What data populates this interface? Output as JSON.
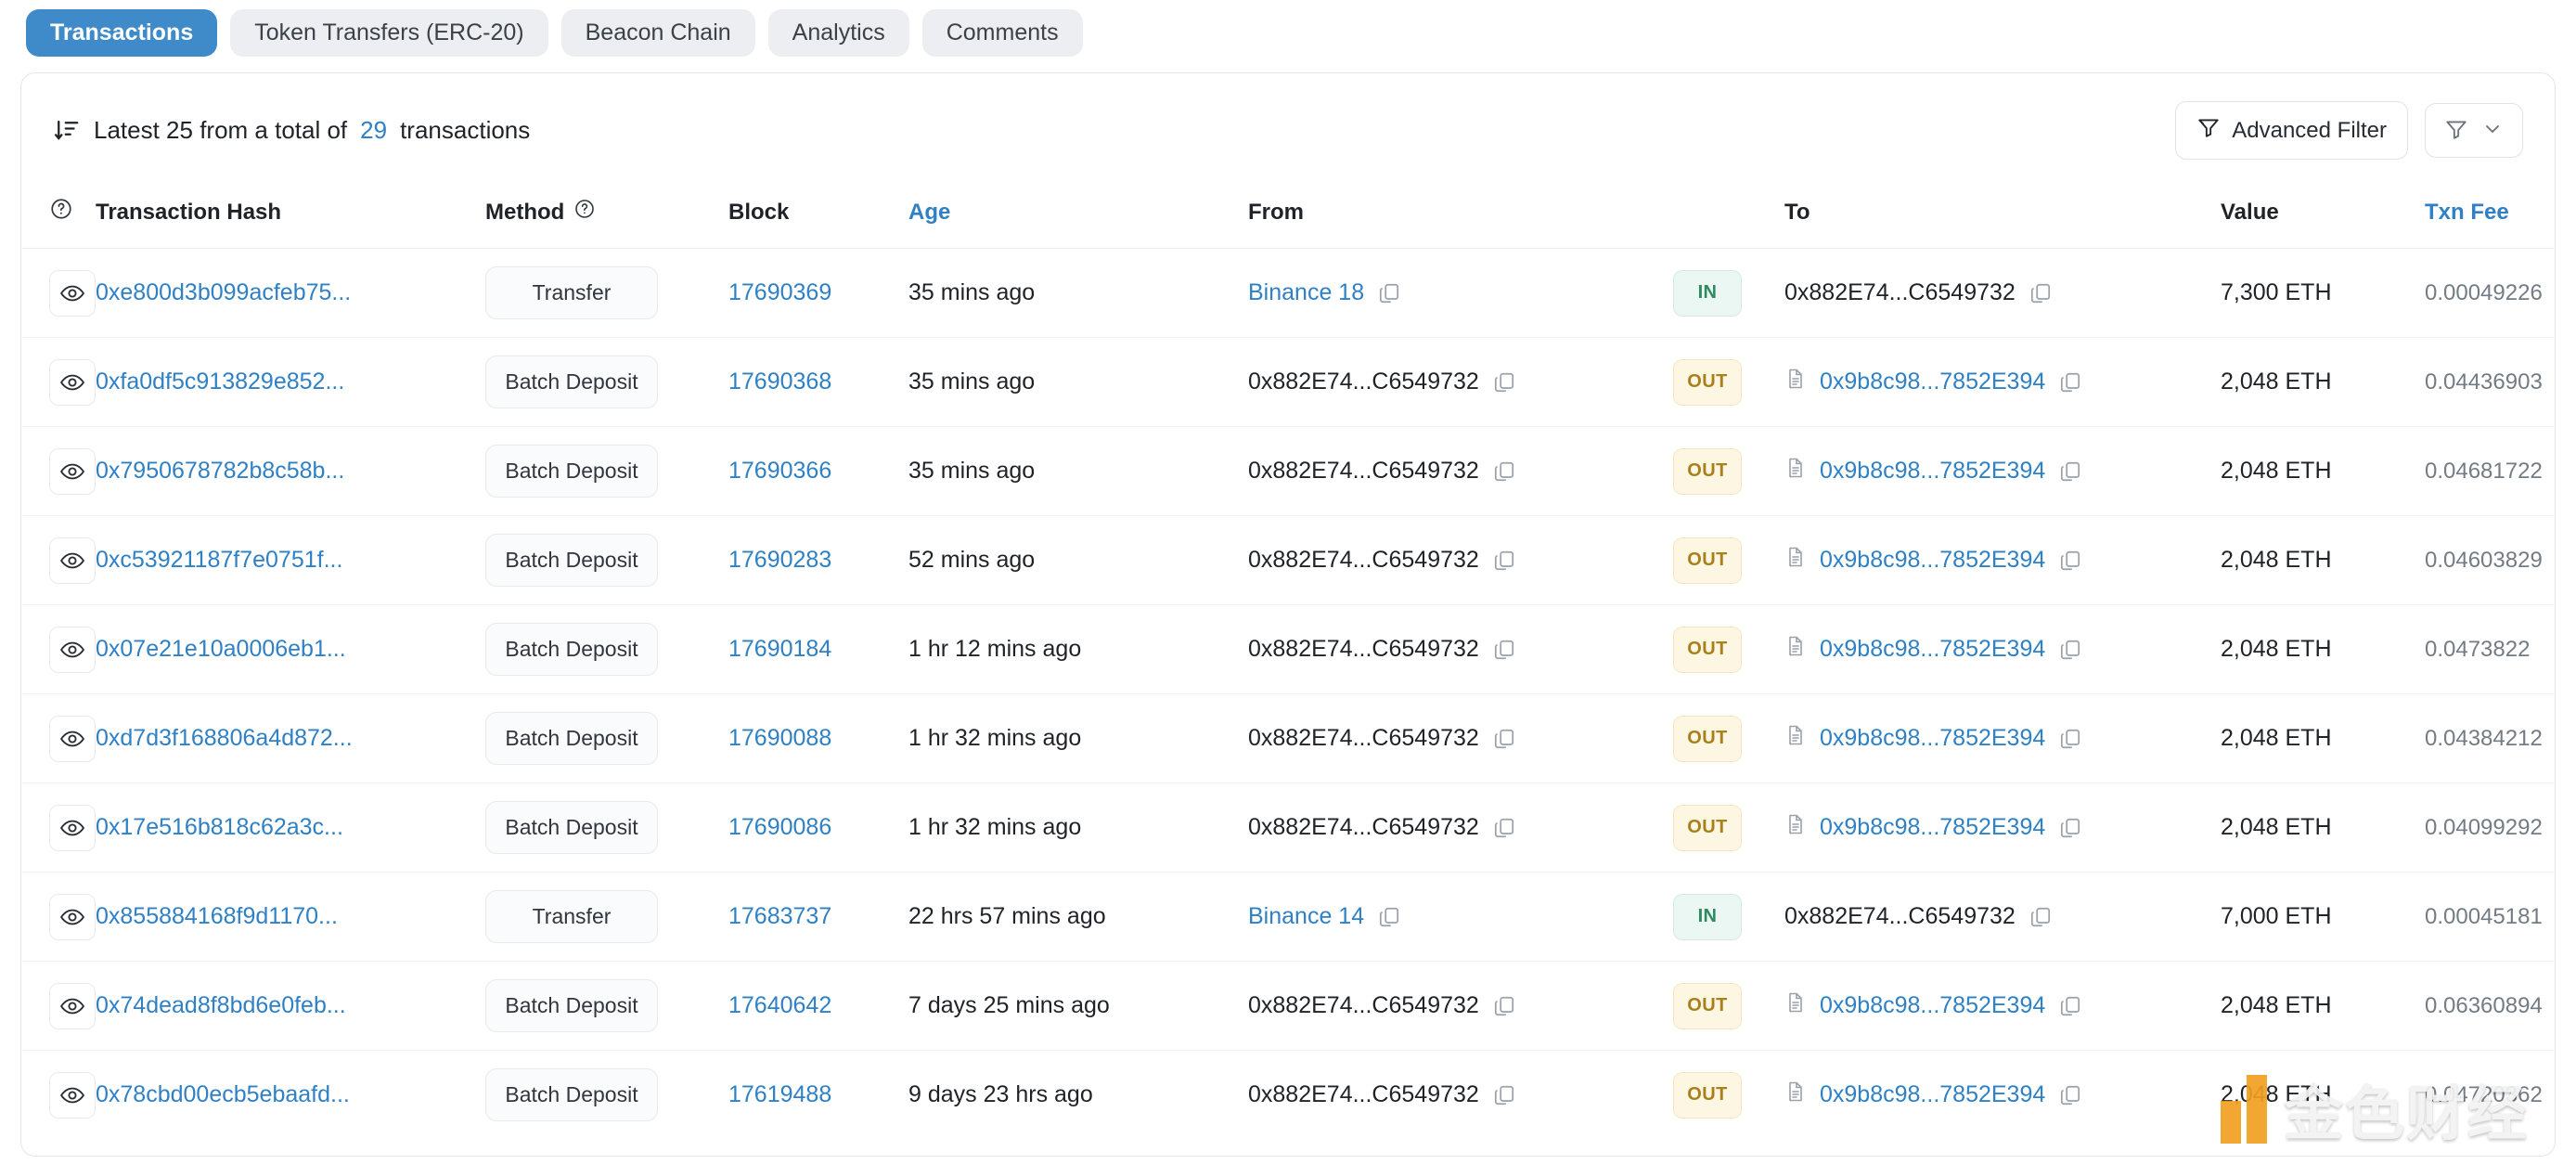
{
  "tabs": [
    {
      "label": "Transactions",
      "active": true
    },
    {
      "label": "Token Transfers (ERC-20)",
      "active": false
    },
    {
      "label": "Beacon Chain",
      "active": false
    },
    {
      "label": "Analytics",
      "active": false
    },
    {
      "label": "Comments",
      "active": false
    }
  ],
  "summary": {
    "prefix": "Latest 25 from a total of",
    "total": "29",
    "suffix": "transactions",
    "sort_icon": "sort-descending-icon"
  },
  "toolbar": {
    "advanced_filter_label": "Advanced Filter",
    "advanced_filter_icon": "funnel-plus-icon",
    "filter_icon": "funnel-icon",
    "chevron_icon": "chevron-down-icon"
  },
  "columns": {
    "info_icon": "question-circle-icon",
    "hash": "Transaction Hash",
    "method": "Method",
    "method_info_icon": "question-circle-icon",
    "block": "Block",
    "age": "Age",
    "from": "From",
    "to": "To",
    "value": "Value",
    "fee": "Txn Fee"
  },
  "colors": {
    "accent": "#3f8bc9",
    "link": "#2f80c4",
    "in_badge_bg": "#ebf7f2",
    "in_badge_text": "#2f8a62",
    "out_badge_bg": "#fdf6e3",
    "out_badge_text": "#a9801c",
    "watermark_orange": "#f0a020"
  },
  "watermark": {
    "text": "金色财经",
    "logo_icon": "jinse-logo-icon"
  },
  "rows": [
    {
      "eye_icon": "eye-icon",
      "hash": "0xe800d3b099acfeb75...",
      "method": "Transfer",
      "block": "17690369",
      "age": "35 mins ago",
      "from": "Binance 18",
      "from_is_link": true,
      "from_has_contract_icon": false,
      "direction": "IN",
      "to": "0x882E74...C6549732",
      "to_is_link": false,
      "to_has_contract_icon": false,
      "value": "7,300 ETH",
      "fee": "0.00049226"
    },
    {
      "eye_icon": "eye-icon",
      "hash": "0xfa0df5c913829e852...",
      "method": "Batch Deposit",
      "block": "17690368",
      "age": "35 mins ago",
      "from": "0x882E74...C6549732",
      "from_is_link": false,
      "from_has_contract_icon": false,
      "direction": "OUT",
      "to": "0x9b8c98...7852E394",
      "to_is_link": true,
      "to_has_contract_icon": true,
      "value": "2,048 ETH",
      "fee": "0.04436903"
    },
    {
      "eye_icon": "eye-icon",
      "hash": "0x7950678782b8c58b...",
      "method": "Batch Deposit",
      "block": "17690366",
      "age": "35 mins ago",
      "from": "0x882E74...C6549732",
      "from_is_link": false,
      "from_has_contract_icon": false,
      "direction": "OUT",
      "to": "0x9b8c98...7852E394",
      "to_is_link": true,
      "to_has_contract_icon": true,
      "value": "2,048 ETH",
      "fee": "0.04681722"
    },
    {
      "eye_icon": "eye-icon",
      "hash": "0xc53921187f7e0751f...",
      "method": "Batch Deposit",
      "block": "17690283",
      "age": "52 mins ago",
      "from": "0x882E74...C6549732",
      "from_is_link": false,
      "from_has_contract_icon": false,
      "direction": "OUT",
      "to": "0x9b8c98...7852E394",
      "to_is_link": true,
      "to_has_contract_icon": true,
      "value": "2,048 ETH",
      "fee": "0.04603829"
    },
    {
      "eye_icon": "eye-icon",
      "hash": "0x07e21e10a0006eb1...",
      "method": "Batch Deposit",
      "block": "17690184",
      "age": "1 hr 12 mins ago",
      "from": "0x882E74...C6549732",
      "from_is_link": false,
      "from_has_contract_icon": false,
      "direction": "OUT",
      "to": "0x9b8c98...7852E394",
      "to_is_link": true,
      "to_has_contract_icon": true,
      "value": "2,048 ETH",
      "fee": "0.0473822"
    },
    {
      "eye_icon": "eye-icon",
      "hash": "0xd7d3f168806a4d872...",
      "method": "Batch Deposit",
      "block": "17690088",
      "age": "1 hr 32 mins ago",
      "from": "0x882E74...C6549732",
      "from_is_link": false,
      "from_has_contract_icon": false,
      "direction": "OUT",
      "to": "0x9b8c98...7852E394",
      "to_is_link": true,
      "to_has_contract_icon": true,
      "value": "2,048 ETH",
      "fee": "0.04384212"
    },
    {
      "eye_icon": "eye-icon",
      "hash": "0x17e516b818c62a3c...",
      "method": "Batch Deposit",
      "block": "17690086",
      "age": "1 hr 32 mins ago",
      "from": "0x882E74...C6549732",
      "from_is_link": false,
      "from_has_contract_icon": false,
      "direction": "OUT",
      "to": "0x9b8c98...7852E394",
      "to_is_link": true,
      "to_has_contract_icon": true,
      "value": "2,048 ETH",
      "fee": "0.04099292"
    },
    {
      "eye_icon": "eye-icon",
      "hash": "0x855884168f9d1170...",
      "method": "Transfer",
      "block": "17683737",
      "age": "22 hrs 57 mins ago",
      "from": "Binance 14",
      "from_is_link": true,
      "from_has_contract_icon": false,
      "direction": "IN",
      "to": "0x882E74...C6549732",
      "to_is_link": false,
      "to_has_contract_icon": false,
      "value": "7,000 ETH",
      "fee": "0.00045181"
    },
    {
      "eye_icon": "eye-icon",
      "hash": "0x74dead8f8bd6e0feb...",
      "method": "Batch Deposit",
      "block": "17640642",
      "age": "7 days 25 mins ago",
      "from": "0x882E74...C6549732",
      "from_is_link": false,
      "from_has_contract_icon": false,
      "direction": "OUT",
      "to": "0x9b8c98...7852E394",
      "to_is_link": true,
      "to_has_contract_icon": true,
      "value": "2,048 ETH",
      "fee": "0.06360894"
    },
    {
      "eye_icon": "eye-icon",
      "hash": "0x78cbd00ecb5ebaafd...",
      "method": "Batch Deposit",
      "block": "17619488",
      "age": "9 days 23 hrs ago",
      "from": "0x882E74...C6549732",
      "from_is_link": false,
      "from_has_contract_icon": false,
      "direction": "OUT",
      "to": "0x9b8c98...7852E394",
      "to_is_link": true,
      "to_has_contract_icon": true,
      "value": "2,048 ETH",
      "fee": "0.04720362"
    }
  ]
}
